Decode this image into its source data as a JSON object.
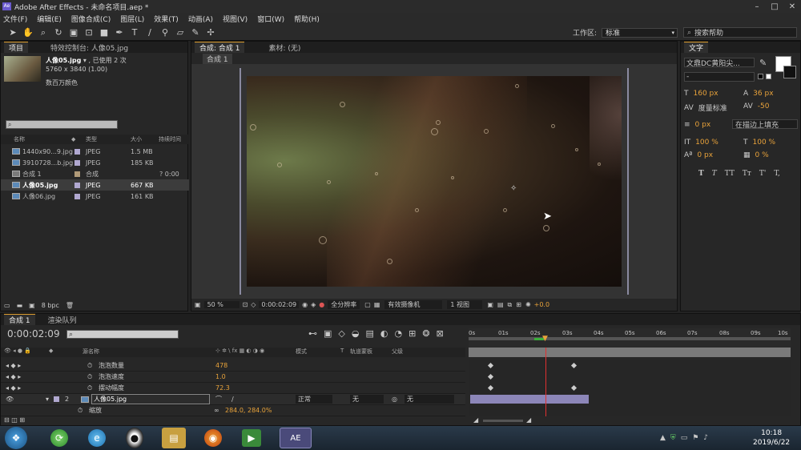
{
  "window": {
    "title": "Adobe After Effects - 未命名项目.aep *"
  },
  "menu": [
    "文件(F)",
    "编辑(E)",
    "图像合成(C)",
    "图层(L)",
    "效果(T)",
    "动画(A)",
    "视图(V)",
    "窗口(W)",
    "帮助(H)"
  ],
  "toolbar": {
    "workspace_label": "工作区:",
    "workspace_value": "标准",
    "search_help": "搜索帮助"
  },
  "project": {
    "tab_project": "项目",
    "tab_effects": "特效控制台: 人像05.jpg",
    "asset_name": "人像05.jpg",
    "asset_used": "▾ , 已使用 2 次",
    "asset_dims": "5760 x 3840 (1.00)",
    "asset_color": "数百万颜色",
    "columns": [
      "名称",
      "类型",
      "大小",
      "持续时间"
    ],
    "items": [
      {
        "name": "1440x90...9.jpg",
        "type": "JPEG",
        "size": "1.5 MB",
        "duration": ""
      },
      {
        "name": "3910728...b.jpg",
        "type": "JPEG",
        "size": "185 KB",
        "duration": ""
      },
      {
        "name": "合成 1",
        "type": "合成",
        "size": "",
        "duration": "? 0:00"
      },
      {
        "name": "人像05.jpg",
        "type": "JPEG",
        "size": "667 KB",
        "duration": ""
      },
      {
        "name": "人像06.jpg",
        "type": "JPEG",
        "size": "161 KB",
        "duration": ""
      }
    ],
    "bpc": "8 bpc"
  },
  "viewer": {
    "tab_comp": "合成: 合成 1",
    "tab_footage": "素材: (无)",
    "breadcrumb": "合成 1",
    "zoom": "50 %",
    "timecode": "0:00:02:09",
    "resolution": "全分辨率",
    "camera": "有效摄像机",
    "views": "1 视图",
    "exposure": "+0.0"
  },
  "text_panel": {
    "title": "文字",
    "font": "文鼎DC黄阳尖...",
    "font_style": "-",
    "size": "160 px",
    "leading": "36 px",
    "kerning": "度量标准",
    "tracking": "-50",
    "stroke_width": "0 px",
    "stroke_mode": "在描边上填充",
    "vscale": "100 %",
    "hscale": "100 %",
    "baseline": "0 px",
    "tsume": "0 %",
    "styles": [
      "T",
      "T",
      "TT",
      "Tт",
      "T'",
      "T,"
    ]
  },
  "timeline": {
    "tab_comp": "合成 1",
    "tab_render": "渲染队列",
    "timecode": "0:00:02:09",
    "columns": [
      "源名称",
      "模式",
      "T",
      "轨道蒙板",
      "父级"
    ],
    "ruler": [
      "0s",
      "01s",
      "02s",
      "03s",
      "04s",
      "05s",
      "06s",
      "07s",
      "08s",
      "09s",
      "10s"
    ],
    "props": [
      {
        "name": "泡泡数量",
        "value": "478"
      },
      {
        "name": "泡泡速度",
        "value": "1.0"
      },
      {
        "name": "摆动幅度",
        "value": "72.3"
      }
    ],
    "layer": {
      "index": "2",
      "name": "人像05.jpg",
      "mode": "正常",
      "matte": "无",
      "parent": "无"
    },
    "scale_label": "缩放",
    "scale_value": "284.0, 284.0%"
  },
  "taskbar": {
    "time": "10:18",
    "date": "2019/6/22",
    "ae_label": "AE"
  }
}
